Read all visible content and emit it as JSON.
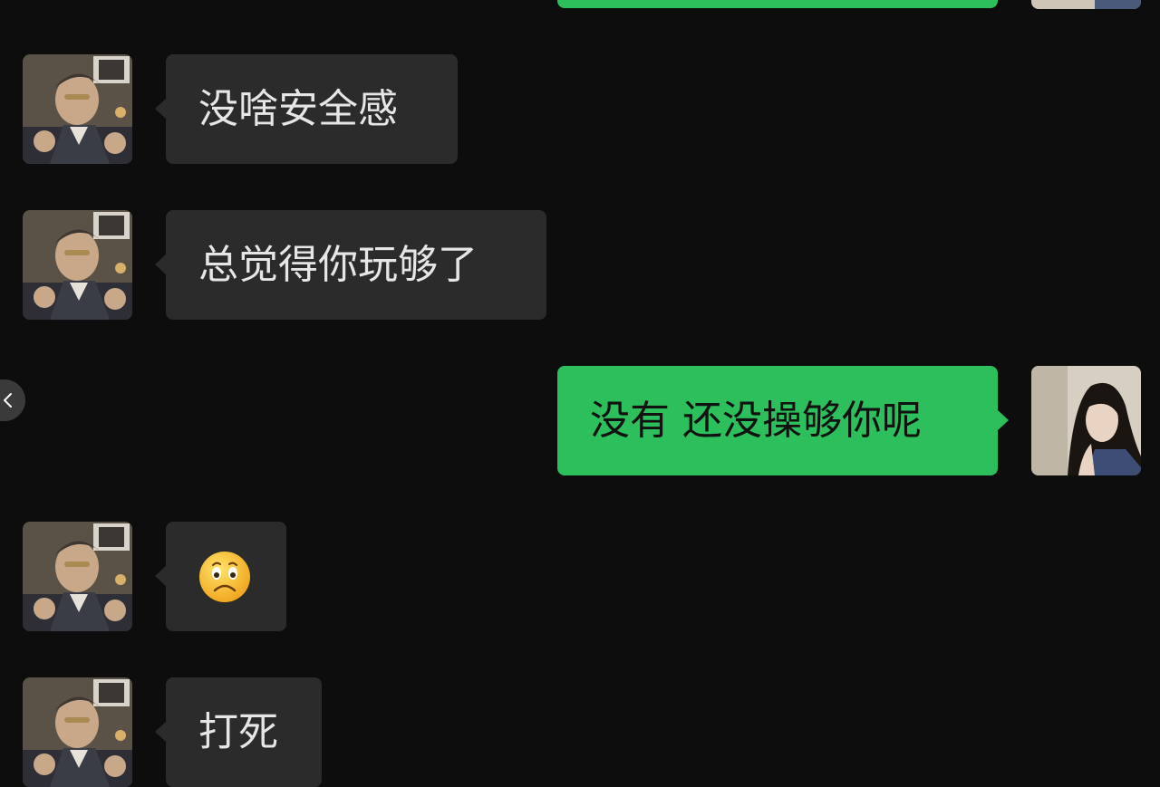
{
  "messages": [
    {
      "side": "out",
      "text": ""
    },
    {
      "side": "in",
      "text": "没啥安全感"
    },
    {
      "side": "in",
      "text": "总觉得你玩够了"
    },
    {
      "side": "out",
      "text": "没有 还没操够你呢"
    },
    {
      "side": "in",
      "emoji": "frowning-face-emoji"
    },
    {
      "side": "in",
      "text": "打死"
    }
  ],
  "colors": {
    "background": "#0d0d0d",
    "incoming_bubble": "#2b2b2b",
    "outgoing_bubble": "#2cbf5b",
    "incoming_text": "#e6e6e6",
    "outgoing_text": "#111111"
  },
  "icons": {
    "back": "chevron-left-icon",
    "emoji": "frowning-face-emoji"
  }
}
